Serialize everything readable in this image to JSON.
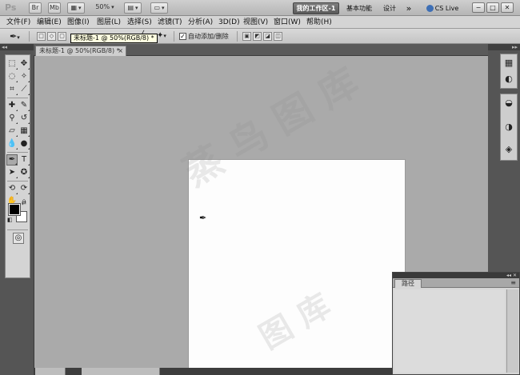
{
  "appbar": {
    "logo": "Ps",
    "zoom_value": "50%",
    "workspaces": [
      "我的工作区-1",
      "基本功能",
      "设计"
    ],
    "more": "»",
    "cs_live": "CS Live",
    "window_controls": [
      "−",
      "□",
      "✕"
    ]
  },
  "menu": [
    "文件(F)",
    "编辑(E)",
    "图像(I)",
    "图层(L)",
    "选择(S)",
    "滤镜(T)",
    "分析(A)",
    "3D(D)",
    "视图(V)",
    "窗口(W)",
    "帮助(H)"
  ],
  "options": {
    "tooltip": "未标题-1 @ 50%(RGB/8) *",
    "auto_add_delete_label": "自动添加/删除",
    "auto_add_delete_checked": "✓"
  },
  "document": {
    "tab_title": "未标题-1 @ 50%(RGB/8) *",
    "tab_close": "×"
  },
  "panels": {
    "paths_tab": "路径",
    "panel_menu": "≡"
  },
  "colors": {
    "foreground": "#000000",
    "background": "#ffffff",
    "workspace": "#aaaaaa",
    "active_workspace_button": "#5a5a5a"
  },
  "icons": {
    "tools": [
      "marquee-icon",
      "move-icon",
      "lasso-icon",
      "magic-wand-icon",
      "crop-icon",
      "eyedropper-icon",
      "healing-brush-icon",
      "brush-icon",
      "clone-stamp-icon",
      "history-brush-icon",
      "eraser-icon",
      "gradient-icon",
      "blur-icon",
      "dodge-icon",
      "pen-icon",
      "type-icon",
      "path-selection-icon",
      "shape-icon",
      "3d-rotate-icon",
      "3d-camera-icon",
      "hand-icon",
      "zoom-icon"
    ],
    "dock": [
      "color-panel-icon",
      "adjustments-icon",
      "masks-icon",
      "layers-icon"
    ]
  }
}
